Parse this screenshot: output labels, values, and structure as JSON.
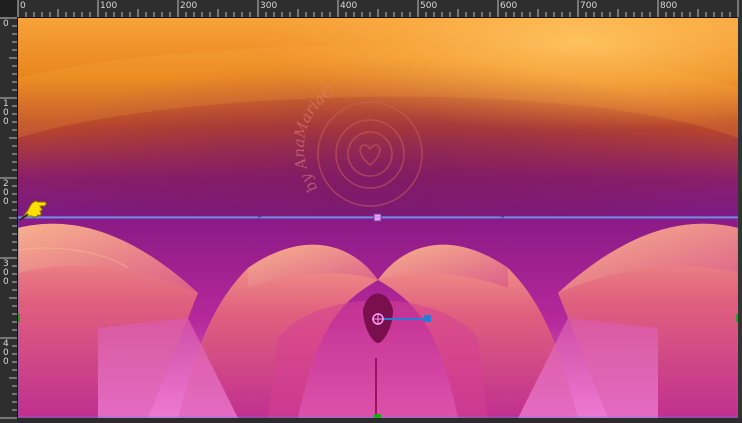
{
  "rulers": {
    "top_labels": [
      "0",
      "100",
      "200",
      "300",
      "400",
      "500",
      "600",
      "700",
      "800"
    ],
    "left_labels": [
      "0",
      "1\n0\n0",
      "2\n0\n0",
      "3\n0\n0",
      "4\n0\n0"
    ]
  },
  "watermark": {
    "text": "by AnaMariaC"
  },
  "icons": {
    "pointer": "pointing-hand-icon",
    "rotation": "rotation-handle-icon",
    "scale": "scale-handle-icon"
  },
  "colors": {
    "guide": "#3a8ee6",
    "selection": "#ff9cf2",
    "handle": "#2b7bd6"
  }
}
